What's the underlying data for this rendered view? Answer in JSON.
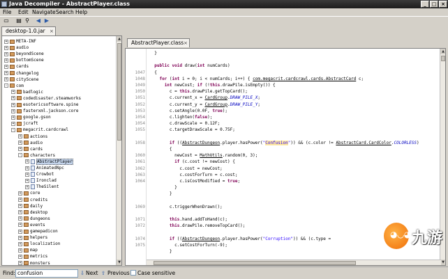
{
  "window": {
    "title": "Java Decompiler - AbstractPlayer.class"
  },
  "menu": [
    "File",
    "Edit",
    "Navigate",
    "Search",
    "Help"
  ],
  "left_tab": {
    "label": "desktop-1.0.jar"
  },
  "tree": [
    {
      "label": "META-INF",
      "depth": 0,
      "exp": "+"
    },
    {
      "label": "audio",
      "depth": 0,
      "exp": "+"
    },
    {
      "label": "beyondScene",
      "depth": 0,
      "exp": "+"
    },
    {
      "label": "bottomScene",
      "depth": 0,
      "exp": "+"
    },
    {
      "label": "cards",
      "depth": 0,
      "exp": "+"
    },
    {
      "label": "changelog",
      "depth": 0,
      "exp": "+"
    },
    {
      "label": "cityScene",
      "depth": 0,
      "exp": "+"
    },
    {
      "label": "com",
      "depth": 0,
      "exp": "-"
    },
    {
      "label": "badlogic",
      "depth": 1,
      "exp": "+"
    },
    {
      "label": "codedisaster.steamworks",
      "depth": 1,
      "exp": "+"
    },
    {
      "label": "esotericsoftware.spine",
      "depth": 1,
      "exp": "+"
    },
    {
      "label": "fasterxml.jackson.core",
      "depth": 1,
      "exp": "+"
    },
    {
      "label": "google.gson",
      "depth": 1,
      "exp": "+"
    },
    {
      "label": "jcraft",
      "depth": 1,
      "exp": "+"
    },
    {
      "label": "megacrit.cardcrawl",
      "depth": 1,
      "exp": "-"
    },
    {
      "label": "actions",
      "depth": 2,
      "exp": "+"
    },
    {
      "label": "audio",
      "depth": 2,
      "exp": "+"
    },
    {
      "label": "cards",
      "depth": 2,
      "exp": "+"
    },
    {
      "label": "characters",
      "depth": 2,
      "exp": "-"
    },
    {
      "label": "AbstractPlayer",
      "depth": 3,
      "exp": "+",
      "cls": true,
      "selected": true
    },
    {
      "label": "AnimatedNpc",
      "depth": 3,
      "exp": "+",
      "cls": true
    },
    {
      "label": "Crowbot",
      "depth": 3,
      "exp": "+",
      "cls": true
    },
    {
      "label": "Ironclad",
      "depth": 3,
      "exp": "+",
      "cls": true
    },
    {
      "label": "TheSilent",
      "depth": 3,
      "exp": "+",
      "cls": true
    },
    {
      "label": "core",
      "depth": 2,
      "exp": "+"
    },
    {
      "label": "credits",
      "depth": 2,
      "exp": "+"
    },
    {
      "label": "daily",
      "depth": 2,
      "exp": "+"
    },
    {
      "label": "desktop",
      "depth": 2,
      "exp": "+"
    },
    {
      "label": "dungeons",
      "depth": 2,
      "exp": "+"
    },
    {
      "label": "events",
      "depth": 2,
      "exp": "+"
    },
    {
      "label": "gamepadicon",
      "depth": 2,
      "exp": "+"
    },
    {
      "label": "helpers",
      "depth": 2,
      "exp": "+"
    },
    {
      "label": "localization",
      "depth": 2,
      "exp": "+"
    },
    {
      "label": "map",
      "depth": 2,
      "exp": "+"
    },
    {
      "label": "metrics",
      "depth": 2,
      "exp": "+"
    },
    {
      "label": "monsters",
      "depth": 2,
      "exp": "+"
    }
  ],
  "editor_tab": {
    "label": "AbstractPlayer.class"
  },
  "code_lines": [
    {
      "num": "",
      "html": "  }"
    },
    {
      "num": "",
      "html": ""
    },
    {
      "num": "",
      "html": "  <span class=\"kw\">public void</span> draw(<span class=\"kw\">int</span> numCards)"
    },
    {
      "num": "1047",
      "html": "  {"
    },
    {
      "num": "1048",
      "html": "    <span class=\"kw\">for</span> (<span class=\"kw\">int</span> i = 0; i &lt; numCards; i++) { <span class=\"lnk\">com.megacrit.cardcrawl.cards.AbstractCard</span> c;"
    },
    {
      "num": "1049",
      "html": "      <span class=\"kw\">int</span> newCost; <span class=\"kw\">if</span> (!<span class=\"kw\">this</span>.drawPile.isEmpty()) {"
    },
    {
      "num": "1050",
      "html": "        c = <span class=\"kw\">this</span>.drawPile.getTopCard();"
    },
    {
      "num": "1051",
      "html": "        c.current_x = <span class=\"lnk\">CardGroup</span>.<span class=\"fld\">DRAW_PILE_X</span>;"
    },
    {
      "num": "1052",
      "html": "        c.current_y = <span class=\"lnk\">CardGroup</span>.<span class=\"fld\">DRAW_PILE_Y</span>;"
    },
    {
      "num": "1053",
      "html": "        c.setAngle(0.0F, <span class=\"kw\">true</span>);"
    },
    {
      "num": "1054",
      "html": "        c.lighten(<span class=\"kw\">false</span>);"
    },
    {
      "num": "1054",
      "html": "        c.drawScale = 0.12F;"
    },
    {
      "num": "1055",
      "html": "        c.targetDrawScale = 0.75F;"
    },
    {
      "num": "",
      "html": ""
    },
    {
      "num": "1058",
      "html": "        <span class=\"kw\">if</span> ((<span class=\"lnk\">AbstractDungeon</span>.player.hasPower(<span class=\"str\">\"<span class=\"hl\">Confusion</span>\"</span>)) &amp;&amp; (c.color != <span class=\"lnk\">AbstractCard.CardColor</span>.<span class=\"fld\">COLORLESS</span>)"
    },
    {
      "num": "",
      "html": "        {"
    },
    {
      "num": "1060",
      "html": "          newCost = <span class=\"lnk\">MathUtils</span>.random(0, 3);"
    },
    {
      "num": "1061",
      "html": "          <span class=\"kw\">if</span> (c.cost != newCost) {"
    },
    {
      "num": "1062",
      "html": "            c.cost = newCost;"
    },
    {
      "num": "1063",
      "html": "            c.costForTurn = c.cost;"
    },
    {
      "num": "1064",
      "html": "            c.isCostModified = <span class=\"kw\">true</span>;"
    },
    {
      "num": "",
      "html": "          }"
    },
    {
      "num": "",
      "html": "        }"
    },
    {
      "num": "",
      "html": ""
    },
    {
      "num": "1069",
      "html": "        c.triggerWhenDrawn();"
    },
    {
      "num": "",
      "html": ""
    },
    {
      "num": "1071",
      "html": "        <span class=\"kw\">this</span>.hand.addToHand(c);"
    },
    {
      "num": "1072",
      "html": "        <span class=\"kw\">this</span>.drawPile.removeTopCard();"
    },
    {
      "num": "",
      "html": ""
    },
    {
      "num": "1074",
      "html": "        <span class=\"kw\">if</span> ((<span class=\"lnk\">AbstractDungeon</span>.player.hasPower(<span class=\"str\">\"Corruption\"</span>)) &amp;&amp; (c.type = "
    },
    {
      "num": "1075",
      "html": "          c.setCostForTurn(-9);"
    },
    {
      "num": "",
      "html": "        }"
    }
  ],
  "find": {
    "label": "Find:",
    "value": "confusion",
    "next": "Next",
    "previous": "Previous",
    "case_sensitive": "Case sensitive"
  },
  "watermark": {
    "text": "九游"
  }
}
